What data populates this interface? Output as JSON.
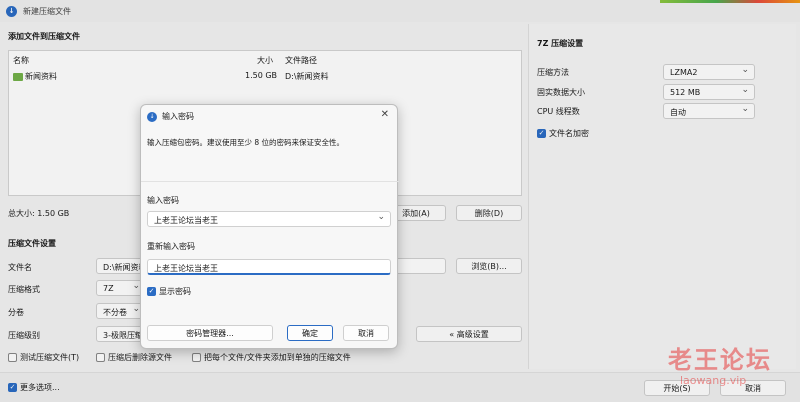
{
  "window": {
    "title": "新建压缩文件"
  },
  "files_section": {
    "title": "添加文件到压缩文件",
    "columns": [
      "名称",
      "大小",
      "文件路径"
    ],
    "rows": [
      {
        "name": "新闻资料",
        "size": "1.50 GB",
        "path": "D:\\新闻资料"
      }
    ],
    "total_size": "总大小: 1.50 GB",
    "add_button": "添加(A)",
    "delete_button": "删除(D)"
  },
  "settings_section": {
    "title": "压缩文件设置",
    "file_name_label": "文件名",
    "file_name_value": "D:\\新闻资料",
    "browse_button": "浏览(B)...",
    "format_label": "压缩格式",
    "format_value": "7Z",
    "split_label": "分卷",
    "split_value": "不分卷",
    "level_label": "压缩级别",
    "level_value": "3-极限压缩",
    "advanced_button": "« 高级设置",
    "test_checkbox": "测试压缩文件(T)",
    "delete_after_checkbox": "压缩后删除源文件",
    "separate_checkbox": "把每个文件/文件夹添加到单独的压缩文件"
  },
  "sevenz_panel": {
    "title": "7Z 压缩设置",
    "method_label": "压缩方法",
    "method_value": "LZMA2",
    "block_label": "固实数据大小",
    "block_value": "512 MB",
    "threads_label": "CPU 线程数",
    "threads_value": "自动",
    "encrypt_names_label": "文件名加密"
  },
  "bottom": {
    "more_options": "更多选项...",
    "start_button": "开始(S)",
    "cancel_button": "取消"
  },
  "dialog": {
    "title": "输入密码",
    "description": "输入压缩包密码。建议使用至少 8 位的密码来保证安全性。",
    "password_label": "输入密码",
    "password_value": "上老王论坛当老王",
    "confirm_label": "重新输入密码",
    "confirm_value": "上老王论坛当老王",
    "show_password": "显示密码",
    "manager_button": "密码管理器...",
    "ok_button": "确定",
    "cancel_button": "取消"
  },
  "watermark": {
    "text": "老王论坛",
    "sub": "laowang.vip"
  },
  "colors": {
    "accent": "#2b6cc4",
    "folder": "#73b24a"
  }
}
